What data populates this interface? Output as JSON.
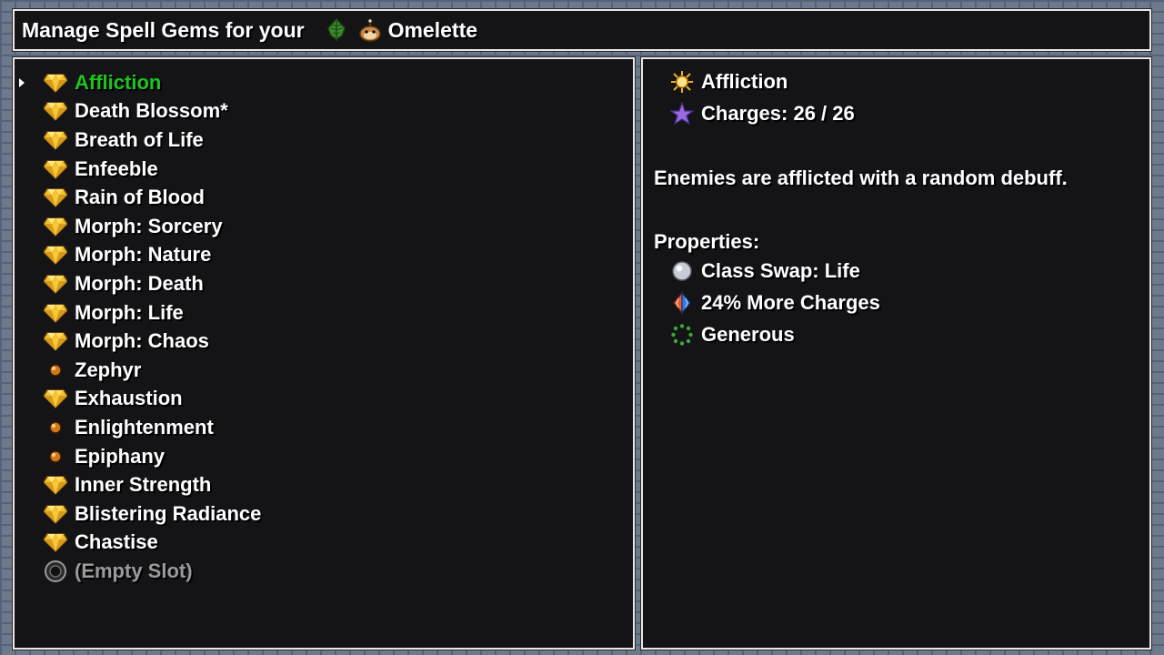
{
  "header": {
    "prefix": "Manage Spell Gems for your",
    "pet_name": "Omelette",
    "leaf_icon": "leaf-icon",
    "pet_icon": "creature-icon"
  },
  "gems": [
    {
      "label": "Affliction",
      "icon": "gem-icon",
      "selected": true
    },
    {
      "label": "Death Blossom*",
      "icon": "gem-icon"
    },
    {
      "label": "Breath of Life",
      "icon": "gem-icon"
    },
    {
      "label": "Enfeeble",
      "icon": "gem-icon"
    },
    {
      "label": "Rain of Blood",
      "icon": "gem-icon"
    },
    {
      "label": "Morph: Sorcery",
      "icon": "gem-icon"
    },
    {
      "label": "Morph: Nature",
      "icon": "gem-icon"
    },
    {
      "label": "Morph: Death",
      "icon": "gem-icon"
    },
    {
      "label": "Morph: Life",
      "icon": "gem-icon"
    },
    {
      "label": "Morph: Chaos",
      "icon": "gem-icon"
    },
    {
      "label": "Zephyr",
      "icon": "orb-icon"
    },
    {
      "label": "Exhaustion",
      "icon": "gem-icon"
    },
    {
      "label": "Enlightenment",
      "icon": "orb-icon"
    },
    {
      "label": "Epiphany",
      "icon": "orb-icon"
    },
    {
      "label": "Inner Strength",
      "icon": "gem-icon"
    },
    {
      "label": "Blistering Radiance",
      "icon": "gem-icon"
    },
    {
      "label": "Chastise",
      "icon": "gem-icon"
    },
    {
      "label": "(Empty Slot)",
      "icon": "empty-slot-icon",
      "empty": true
    }
  ],
  "detail": {
    "name": "Affliction",
    "name_icon": "sun-icon",
    "charges_label": "Charges: 26 / 26",
    "charges_icon": "star-icon",
    "description": "Enemies are afflicted with a random debuff.",
    "properties_heading": "Properties:",
    "properties": [
      {
        "label": "Class Swap: Life",
        "icon": "pearl-icon"
      },
      {
        "label": "24% More Charges",
        "icon": "split-crystal-icon"
      },
      {
        "label": "Generous",
        "icon": "ring-dots-icon"
      }
    ]
  },
  "colors": {
    "selected": "#1ec41e",
    "empty": "#9a9a9a",
    "gem_gold": "#f2c230"
  }
}
